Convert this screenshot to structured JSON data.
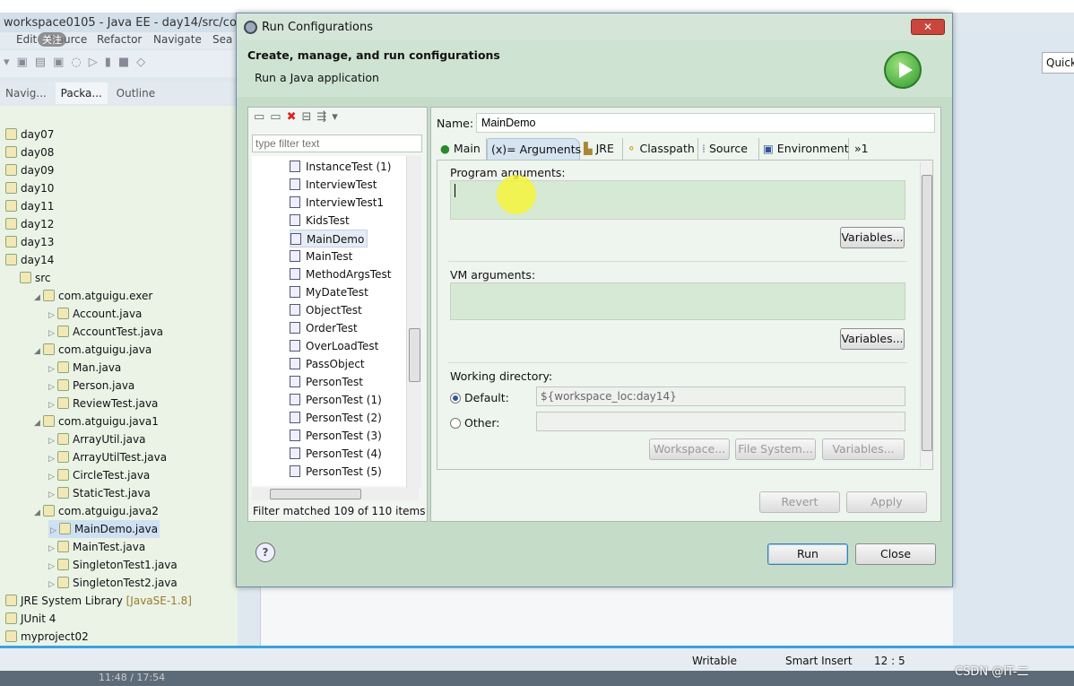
{
  "ide": {
    "title": "workspace0105 - Java EE - day14/src/com/a",
    "menu": [
      "Edit",
      "Source",
      "Refactor",
      "Navigate",
      "Sea"
    ],
    "overlay_text": "关注",
    "view_tabs": [
      "Navig...",
      "Packa...",
      "Outline"
    ],
    "quick_access": "Quick",
    "tree": [
      {
        "label": "day07",
        "indent": 0
      },
      {
        "label": "day08",
        "indent": 0
      },
      {
        "label": "day09",
        "indent": 0
      },
      {
        "label": "day10",
        "indent": 0
      },
      {
        "label": "day11",
        "indent": 0
      },
      {
        "label": "day12",
        "indent": 0
      },
      {
        "label": "day13",
        "indent": 0
      },
      {
        "label": "day14",
        "indent": 0
      },
      {
        "label": "src",
        "indent": 1
      },
      {
        "label": "com.atguigu.exer",
        "indent": 2
      },
      {
        "label": "Account.java",
        "indent": 3
      },
      {
        "label": "AccountTest.java",
        "indent": 3
      },
      {
        "label": "com.atguigu.java",
        "indent": 2
      },
      {
        "label": "Man.java",
        "indent": 3
      },
      {
        "label": "Person.java",
        "indent": 3
      },
      {
        "label": "ReviewTest.java",
        "indent": 3
      },
      {
        "label": "com.atguigu.java1",
        "indent": 2
      },
      {
        "label": "ArrayUtil.java",
        "indent": 3
      },
      {
        "label": "ArrayUtilTest.java",
        "indent": 3
      },
      {
        "label": "CircleTest.java",
        "indent": 3
      },
      {
        "label": "StaticTest.java",
        "indent": 3
      },
      {
        "label": "com.atguigu.java2",
        "indent": 2
      },
      {
        "label": "MainDemo.java",
        "indent": 3,
        "selected": true
      },
      {
        "label": "MainTest.java",
        "indent": 3
      },
      {
        "label": "SingletonTest1.java",
        "indent": 3
      },
      {
        "label": "SingletonTest2.java",
        "indent": 3
      },
      {
        "label": "JRE System Library",
        "indent": 0,
        "decor": "[JavaSE-1.8]"
      },
      {
        "label": "JUnit 4",
        "indent": 0
      },
      {
        "label": "myproject02",
        "indent": 0
      }
    ],
    "status": {
      "writable": "Writable",
      "insert_mode": "Smart Insert",
      "position": "12 : 5"
    },
    "taskbar_time": "11:48 / 17:54",
    "watermark": "CSDN @IT-二"
  },
  "dialog": {
    "title": "Run Configurations",
    "close": "✕",
    "header_title": "Create, manage, and run configurations",
    "header_subtitle": "Run a Java application",
    "filter_placeholder": "type filter text",
    "configs": [
      "InstanceTest (1)",
      "InterviewTest",
      "InterviewTest1",
      "KidsTest",
      "MainDemo",
      "MainTest",
      "MethodArgsTest",
      "MyDateTest",
      "ObjectTest",
      "OrderTest",
      "OverLoadTest",
      "PassObject",
      "PersonTest",
      "PersonTest (1)",
      "PersonTest (2)",
      "PersonTest (3)",
      "PersonTest (4)",
      "PersonTest (5)"
    ],
    "selected_config": "MainDemo",
    "filter_status": "Filter matched 109 of 110 items",
    "name_label": "Name:",
    "name_value": "MainDemo",
    "tabs": [
      "Main",
      "(x)= Arguments",
      "JRE",
      "Classpath",
      "Source",
      "Environment",
      "»1"
    ],
    "active_tab": "(x)= Arguments",
    "program_args_label": "Program arguments:",
    "program_args_value": "",
    "vm_args_label": "VM arguments:",
    "vm_args_value": "",
    "variables": "Variables...",
    "working_dir_label": "Working directory:",
    "default_label": "Default:",
    "default_value": "${workspace_loc:day14}",
    "other_label": "Other:",
    "other_value": "",
    "working_dir_choice": "Default",
    "workspace_btn": "Workspace...",
    "filesystem_btn": "File System...",
    "revert": "Revert",
    "apply": "Apply",
    "run": "Run",
    "close_btn": "Close",
    "help": "?"
  }
}
